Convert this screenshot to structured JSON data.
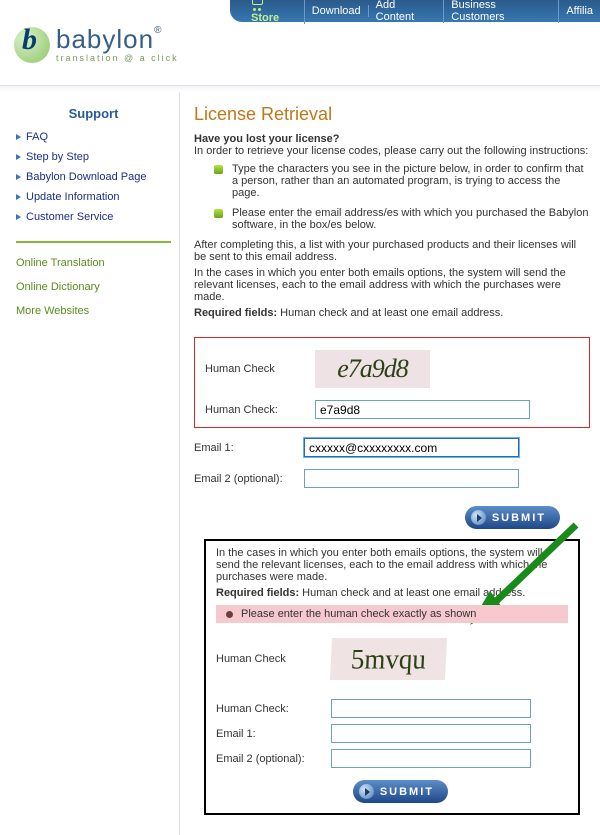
{
  "topnav": {
    "store": "Store",
    "download": "Download",
    "add_content": "Add Content",
    "business": "Business Customers",
    "affilia": "Affilia"
  },
  "logo": {
    "name": "babylon",
    "tagline": "translation @ a click"
  },
  "sidebar": {
    "heading": "Support",
    "items": [
      "FAQ",
      "Step by Step",
      "Babylon Download Page",
      "Update Information",
      "Customer Service"
    ],
    "sublinks": [
      "Online Translation",
      "Online Dictionary",
      "More Websites"
    ]
  },
  "main": {
    "h1": "License Retrieval",
    "lost_q": "Have you lost your license?",
    "intro": "In order to retrieve your license codes, please carry out the following instructions:",
    "b1": "Type the characters you see in the picture below, in order to confirm that a person, rather than an automated program, is trying to access the page.",
    "b2": "Please enter the email address/es with which you purchased the Babylon software, in the box/es below.",
    "p_after": "After completing this, a list with your purchased products and their licenses will be sent to this email address.",
    "p_cases": "In the cases in which you enter both emails options, the system will send the relevant licenses, each to the email address with which the purchases were made.",
    "req_label": "Required fields:",
    "req_text": " Human check and at least one email address.",
    "hc_label": "Human Check",
    "captcha1": "e7a9d8",
    "hc_colon": "Human Check:",
    "hc_value": "e7a9d8",
    "email1_label": "Email 1:",
    "email1_value": "cxxxxx@cxxxxxxxx.com",
    "email2_label": "Email 2 (optional):",
    "submit": "SUBMIT"
  },
  "inset": {
    "p_cases": "In the cases in which you enter both emails options, the system will send the relevant licenses, each to the email address with which the purchases were made.",
    "req_label": "Required fields:",
    "req_text": " Human check and at least one email address.",
    "error": "Please enter the human check exactly as shown",
    "hc_label": "Human Check",
    "captcha2": "5mvqu",
    "hc_colon": "Human Check:",
    "email1_label": "Email 1:",
    "email2_label": "Email 2 (optional):",
    "submit": "SUBMIT"
  }
}
